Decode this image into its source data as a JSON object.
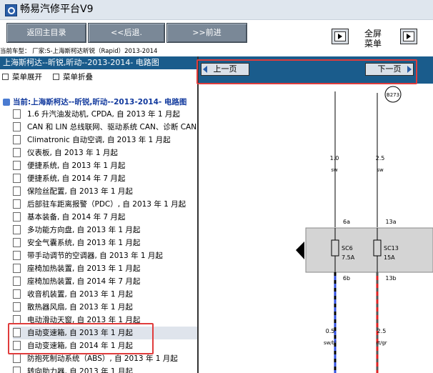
{
  "app": {
    "title": "畅易汽修平台V9"
  },
  "toolbar": {
    "home_label": "返回主目录",
    "back_label": "<<后退.",
    "forward_label": ">>前进",
    "fullscreen_line1": "全屏",
    "fullscreen_line2": "菜单"
  },
  "breadcrumb": "当前车型： 厂家:S-上海斯柯达昕锐（Rapid）2013-2014",
  "sidebar": {
    "header": "上海斯柯达--昕锐,昕动--2013-2014- 电路图",
    "expand_label": "菜单展开",
    "collapse_label": "菜单折叠",
    "root_label": "当前:上海斯柯达--昕锐,昕动--2013-2014- 电路图",
    "items": [
      "1.6 升汽油发动机, CPDA, 自 2013 年 1 月起",
      "CAN 和 LIN 总线联网、驱动系统 CAN、诊断 CAN",
      "Climatronic 自动空调, 自 2013 年 1 月起",
      "仪表板, 自 2013 年 1 月起",
      "便捷系统, 自 2013 年 1 月起",
      "便捷系统, 自 2014 年 7 月起",
      "保险丝配置, 自 2013 年 1 月起",
      "后部驻车距离报警（PDC）, 自 2013 年 1 月起",
      "基本装备, 自 2014 年 7 月起",
      "多功能方向盘, 自 2013 年 1 月起",
      "安全气囊系统, 自 2013 年 1 月起",
      "带手动调节的空调器, 自 2013 年 1 月起",
      "座椅加热装置, 自 2013 年 1 月起",
      "座椅加热装置, 自 2014 年 7 月起",
      "收音机装置, 自 2013 年 1 月起",
      "散热器风扇, 自 2013 年 1 月起",
      "电动滑动天窗, 自 2013 年 1 月起",
      "自动变速箱, 自 2013 年 1 月起",
      "自动变速箱, 自 2014 年 1 月起",
      "防抱死制动系统（ABS）, 自 2013 年 1 月起",
      "转向助力器, 自 2013 年 1 月起"
    ]
  },
  "viewer": {
    "prev_label": "上一页",
    "next_label": "下一页"
  },
  "diagram": {
    "connector": "B273",
    "wire_left": {
      "size": "1.0",
      "color": "sw"
    },
    "wire_right": {
      "size": "2.5",
      "color": "sw"
    },
    "pin_top_left": "6a",
    "pin_top_right": "13a",
    "fuse_left": {
      "name": "SC6",
      "rating": "7.5A"
    },
    "fuse_right": {
      "name": "SC13",
      "rating": "15A"
    },
    "pin_bottom_left": "6b",
    "pin_bottom_right": "13b",
    "wire_bottom_left": {
      "size": "0.5",
      "color": "sw/bl"
    },
    "wire_bottom_right": {
      "size": "2.5",
      "color": "rt/gr"
    }
  },
  "colors": {
    "header_blue": "#1a5c8c",
    "button_gray": "#7a8897",
    "highlight_red": "#e03c3c",
    "wire_blue": "#3050e0",
    "wire_red": "#e02020"
  }
}
